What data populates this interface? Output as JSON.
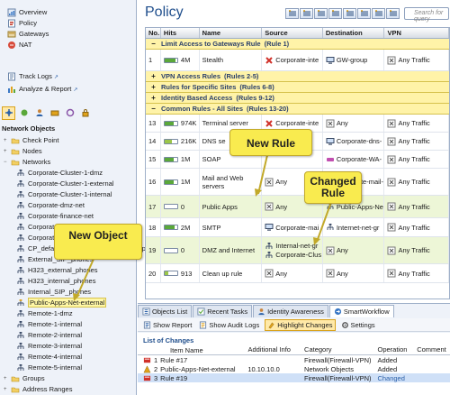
{
  "nav": {
    "items": [
      {
        "label": "Overview",
        "icon": "overview-icon"
      },
      {
        "label": "Policy",
        "icon": "policy-icon"
      },
      {
        "label": "Gateways",
        "icon": "gateways-icon"
      },
      {
        "label": "NAT",
        "icon": "nat-icon"
      }
    ],
    "links": [
      {
        "label": "Track Logs",
        "icon": "track-logs-icon"
      },
      {
        "label": "Analyze & Report",
        "icon": "analyze-report-icon"
      }
    ]
  },
  "objects": {
    "title": "Network Objects",
    "toolbar_icons": [
      "network-filter-icon",
      "services-icon",
      "users-icon",
      "vpn-icon",
      "resources-icon",
      "lock-icon"
    ],
    "tree": [
      {
        "label": "Check Point",
        "level": 1,
        "expander": "+",
        "icon": "checkpoint-folder-icon"
      },
      {
        "label": "Nodes",
        "level": 1,
        "expander": "+",
        "icon": "nodes-folder-icon"
      },
      {
        "label": "Networks",
        "level": 1,
        "expander": "−",
        "icon": "networks-folder-icon"
      },
      {
        "label": "Corporate-Cluster-1-dmz",
        "level": 2,
        "icon": "network-icon"
      },
      {
        "label": "Corporate-Cluster-1-external",
        "level": 2,
        "icon": "network-icon"
      },
      {
        "label": "Corporate-Cluster-1-internal",
        "level": 2,
        "icon": "network-icon"
      },
      {
        "label": "Corporate-dmz-net",
        "level": 2,
        "icon": "network-icon"
      },
      {
        "label": "Corporate-finance-net",
        "level": 2,
        "icon": "network-icon"
      },
      {
        "label": "Corporate-hr-net",
        "level": 2,
        "icon": "network-icon"
      },
      {
        "label": "Corporate-internal-net",
        "level": 2,
        "icon": "network-icon"
      },
      {
        "label": "CP_default_Office_Mode_addresses_pool",
        "level": 2,
        "icon": "network-icon"
      },
      {
        "label": "External_SIP_phones",
        "level": 2,
        "icon": "network-icon"
      },
      {
        "label": "H323_external_phones",
        "level": 2,
        "icon": "network-icon"
      },
      {
        "label": "H323_internal_phones",
        "level": 2,
        "icon": "network-icon"
      },
      {
        "label": "Internal_SIP_phones",
        "level": 2,
        "icon": "network-icon"
      },
      {
        "label": "Public-Apps-Net-external",
        "level": 2,
        "icon": "network-new-icon",
        "selected": true
      },
      {
        "label": "Remote-1-dmz",
        "level": 2,
        "icon": "network-icon"
      },
      {
        "label": "Remote-1-internal",
        "level": 2,
        "icon": "network-icon"
      },
      {
        "label": "Remote-2-internal",
        "level": 2,
        "icon": "network-icon"
      },
      {
        "label": "Remote-3-internal",
        "level": 2,
        "icon": "network-icon"
      },
      {
        "label": "Remote-4-internal",
        "level": 2,
        "icon": "network-icon"
      },
      {
        "label": "Remote-5-internal",
        "level": 2,
        "icon": "network-icon"
      },
      {
        "label": "Groups",
        "level": 1,
        "expander": "+",
        "icon": "groups-folder-icon"
      },
      {
        "label": "Address Ranges",
        "level": 1,
        "expander": "+",
        "icon": "address-ranges-folder-icon"
      }
    ]
  },
  "policy": {
    "title": "Policy",
    "search_placeholder": "Search for query",
    "toolbar_icons": [
      "add-rule-above-icon",
      "add-rule-below-icon",
      "add-rule-top-icon",
      "add-rule-bottom-icon",
      "add-section-icon",
      "collapse-icon",
      "filter-icon",
      "view-icon"
    ],
    "columns": [
      "No.",
      "Hits",
      "Name",
      "Source",
      "Destination",
      "VPN"
    ],
    "sections": [
      {
        "marker": "−",
        "title": "Limit Access to Gateways Rule",
        "rules": "(Rule 1)"
      },
      {
        "marker": "+",
        "title": "VPN Access Rules",
        "rules": "(Rules 2-5)"
      },
      {
        "marker": "+",
        "title": "Rules for Specific Sites",
        "rules": "(Rules 6-8)"
      },
      {
        "marker": "+",
        "title": "Identity Based Access",
        "rules": "(Rules 9-12)"
      },
      {
        "marker": "−",
        "title": "Common Rules - All Sites",
        "rules": "(Rules 13-20)"
      }
    ],
    "rule1": {
      "no": "1",
      "hits": "4M",
      "level": 0.85,
      "name": "Stealth",
      "source_icon": "red-x-icon",
      "source": "Corporate-inte",
      "destination": "GW-group",
      "vpn": "Any Traffic"
    },
    "rules": [
      {
        "no": "13",
        "hits": "974K",
        "level": 0.7,
        "name": "Terminal server",
        "source_icon": "red-x-icon",
        "source": "Corporate-inte",
        "destination_icon": "any-icon",
        "destination": "Any",
        "vpn": "Any Traffic"
      },
      {
        "no": "14",
        "hits": "216K",
        "level": 0.55,
        "name": "DNS se",
        "source_icon": "",
        "source": "",
        "destination_icon": "computer-icon",
        "destination": "Corporate-dns-",
        "vpn": "Any Traffic"
      },
      {
        "no": "15",
        "hits": "1M",
        "level": 0.75,
        "name": "SOAP",
        "source_icon": "",
        "source": "",
        "destination_icon": "globe-icon",
        "destination": "Corporate-WA-",
        "vpn": "Any Traffic"
      },
      {
        "no": "16",
        "hits": "1M",
        "level": 0.75,
        "name": "Mail and Web servers",
        "source_icon": "any-icon",
        "source": "Any",
        "destination_icon": "computer-icon",
        "destination": "Corporate-mail-",
        "vpn": "Any Traffic"
      },
      {
        "no": "17",
        "hits": "0",
        "level": 0,
        "name": "Public Apps",
        "source_icon": "any-icon",
        "source": "Any",
        "destination_icon": "network-icon",
        "destination": "Public-Apps-Ne",
        "vpn": "Any Traffic",
        "highlight": true
      },
      {
        "no": "18",
        "hits": "2M",
        "level": 0.8,
        "name": "SMTP",
        "source_icon": "computer-icon",
        "source": "Corporate-mai",
        "destination_icon": "network-icon",
        "destination": "Internet-net-gr",
        "vpn": "Any Traffic"
      },
      {
        "no": "19",
        "hits": "0",
        "level": 0,
        "name": "DMZ and Internet",
        "source_icon": "network-icon",
        "source": "Internal-net-gr",
        "source2": "Corporate-Clus",
        "destination_icon": "any-icon",
        "destination": "Any",
        "vpn": "Any Traffic",
        "highlight": true
      },
      {
        "no": "20",
        "hits": "913",
        "level": 0.3,
        "name": "Clean up rule",
        "source_icon": "any-icon",
        "source": "Any",
        "destination_icon": "any-icon",
        "destination": "Any",
        "vpn": "Any Traffic"
      }
    ]
  },
  "callouts": {
    "new_rule": "New Rule",
    "changed_rule": "Changed Rule",
    "new_object": "New Object"
  },
  "bottom": {
    "tabs": [
      {
        "label": "Objects List",
        "icon": "objects-list-icon"
      },
      {
        "label": "Recent Tasks",
        "icon": "recent-tasks-icon"
      },
      {
        "label": "Identity Awareness",
        "icon": "identity-awareness-icon"
      },
      {
        "label": "SmartWorkflow",
        "icon": "smartworkflow-icon",
        "active": true
      }
    ],
    "tools": [
      {
        "label": "Show Report",
        "icon": "report-icon"
      },
      {
        "label": "Show Audit Logs",
        "icon": "audit-logs-icon"
      },
      {
        "label": "Highlight Changes",
        "icon": "highlight-icon",
        "active": true
      },
      {
        "label": "Settings",
        "icon": "settings-icon"
      }
    ],
    "list_title": "List of Changes",
    "columns": [
      "Item Name",
      "Additional Info",
      "Category",
      "Operation",
      "Comment"
    ],
    "rows": [
      {
        "num": "1",
        "name": "Rule #17",
        "info": "",
        "category": "Firewall(Firewall-VPN)",
        "operation": "Added",
        "comment": ""
      },
      {
        "num": "2",
        "name": "Public-Apps-Net-external",
        "info": "10.10.10.0",
        "category": "Network Objects",
        "operation": "Added",
        "comment": ""
      },
      {
        "num": "3",
        "name": "Rule #19",
        "info": "",
        "category": "Firewall(Firewall-VPN)",
        "operation": "Changed",
        "comment": "",
        "selected": true
      }
    ]
  },
  "colors": {
    "accent": "#1f4e8c",
    "callout": "#f9eb4f",
    "section": "#fff3a8",
    "highlight_row": "#edf6d7",
    "changed": "#2a5fa8"
  }
}
